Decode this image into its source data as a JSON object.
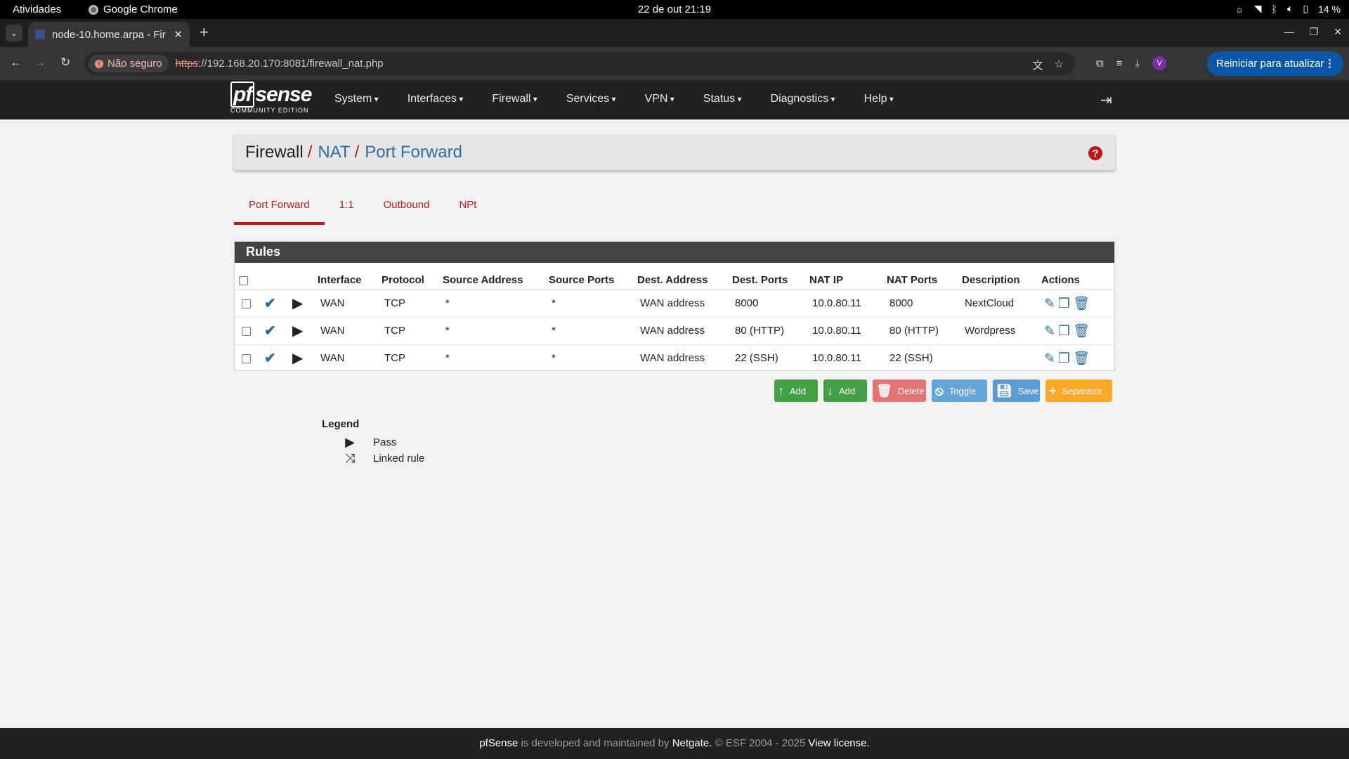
{
  "gnome": {
    "activities": "Atividades",
    "app_name": "Google Chrome",
    "clock": "22 de out  21:19",
    "battery": "14 %"
  },
  "browser": {
    "tab_title": "node-10.home.arpa - Fir",
    "security_label": "Não seguro",
    "url_scheme": "https",
    "url_rest": "://192.168.20.170:8081/firewall_nat.php",
    "profile_initial": "V",
    "update_label": "Reiniciar para atualizar"
  },
  "pfsense": {
    "logo_text": "sense",
    "logo_pf": "pf",
    "logo_sub": "COMMUNITY EDITION",
    "menu": [
      "System",
      "Interfaces",
      "Firewall",
      "Services",
      "VPN",
      "Status",
      "Diagnostics",
      "Help"
    ]
  },
  "breadcrumb": {
    "root": "Firewall",
    "level1": "NAT",
    "level2": "Port Forward",
    "sep": "/"
  },
  "tabs": [
    "Port Forward",
    "1:1",
    "Outbound",
    "NPt"
  ],
  "rules": {
    "heading": "Rules",
    "columns": [
      "",
      "",
      "",
      "Interface",
      "Protocol",
      "Source Address",
      "Source Ports",
      "Dest. Address",
      "Dest. Ports",
      "NAT IP",
      "NAT Ports",
      "Description",
      "Actions"
    ],
    "rows": [
      {
        "interface": "WAN",
        "protocol": "TCP",
        "src_addr": "*",
        "src_ports": "*",
        "dest_addr": "WAN address",
        "dest_ports": "8000",
        "nat_ip": "10.0.80.11",
        "nat_ports": "8000",
        "description": "NextCloud"
      },
      {
        "interface": "WAN",
        "protocol": "TCP",
        "src_addr": "*",
        "src_ports": "*",
        "dest_addr": "WAN address",
        "dest_ports": "80 (HTTP)",
        "nat_ip": "10.0.80.11",
        "nat_ports": "80 (HTTP)",
        "description": "Wordpress"
      },
      {
        "interface": "WAN",
        "protocol": "TCP",
        "src_addr": "*",
        "src_ports": "*",
        "dest_addr": "WAN address",
        "dest_ports": "22 (SSH)",
        "nat_ip": "10.0.80.11",
        "nat_ports": "22 (SSH)",
        "description": ""
      }
    ]
  },
  "buttons": {
    "add_top": "Add",
    "add_bottom": "Add",
    "delete": "Delete",
    "toggle": "Toggle",
    "save": "Save",
    "separator": "Separator"
  },
  "legend": {
    "title": "Legend",
    "pass": "Pass",
    "linked": "Linked rule"
  },
  "footer": {
    "brand": "pfSense",
    "text1": " is developed and maintained by ",
    "company": "Netgate.",
    "text2": " © ESF 2004 - 2025 ",
    "license": "View license."
  },
  "colors": {
    "accent_red": "#b71c1c",
    "link_blue": "#2e6da4",
    "navbar": "#212121"
  }
}
